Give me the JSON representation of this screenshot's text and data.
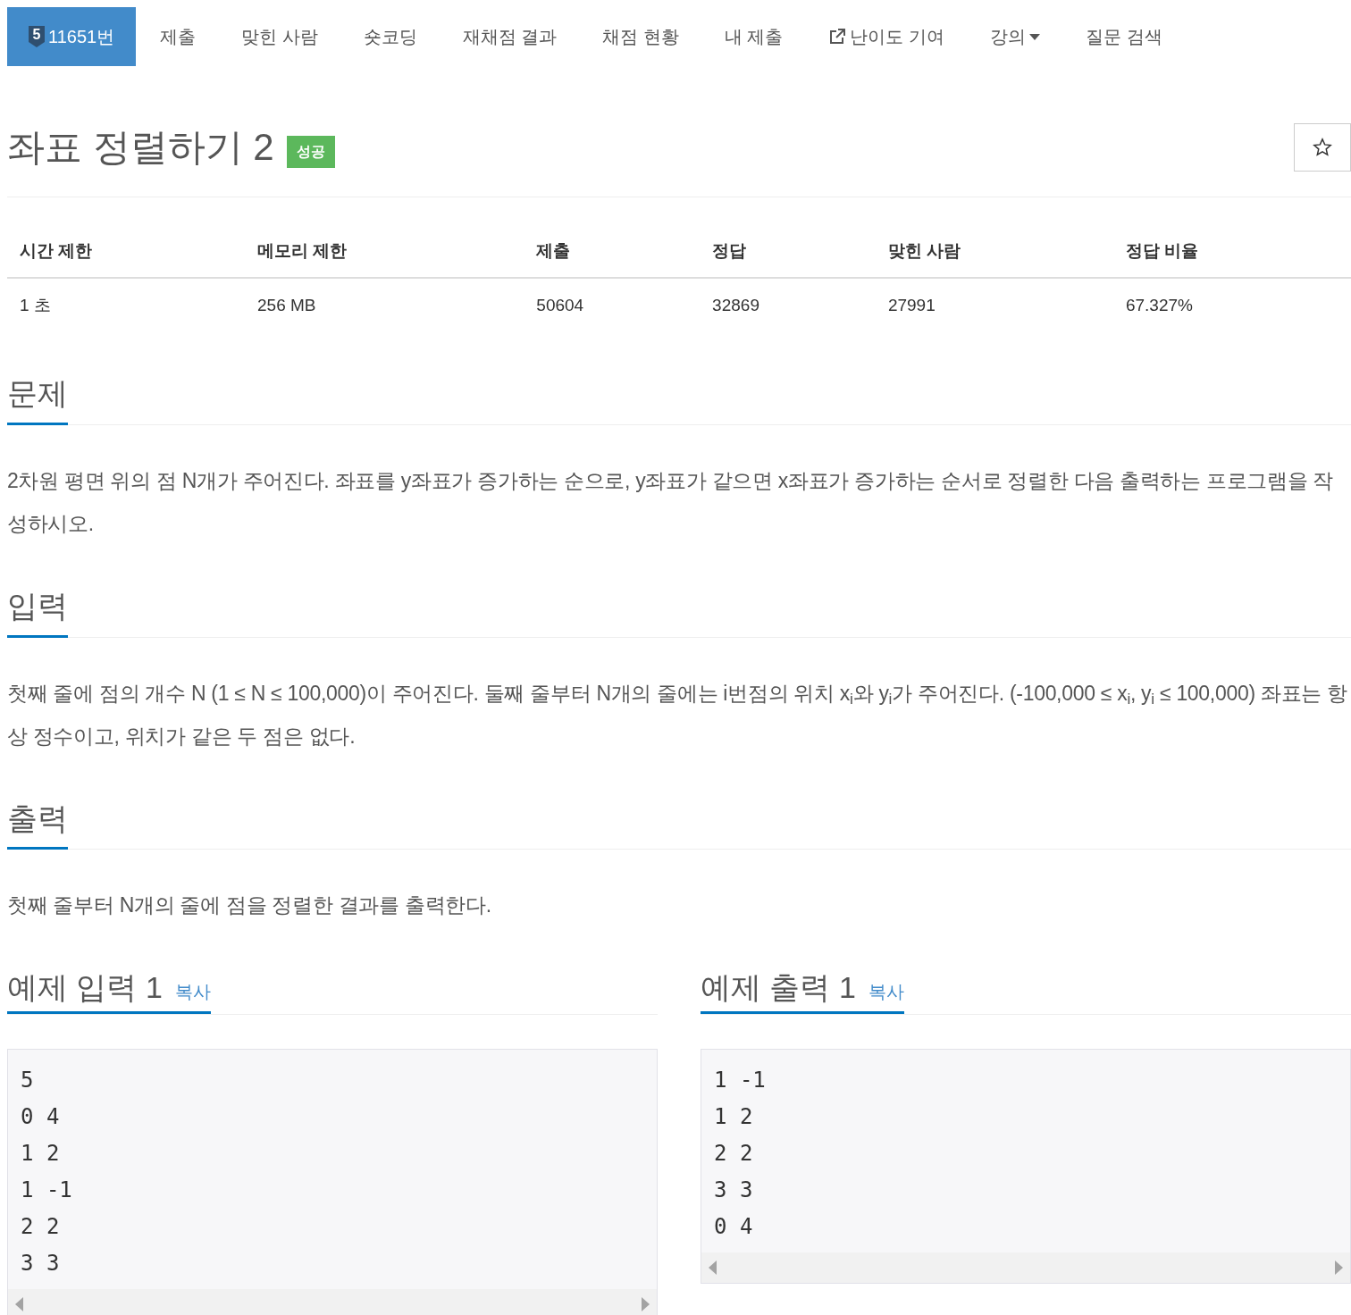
{
  "nav": [
    {
      "label": "11651번",
      "kind": "problem",
      "tier": "5",
      "selected": true
    },
    {
      "label": "제출",
      "kind": "plain",
      "selected": false
    },
    {
      "label": "맞힌 사람",
      "kind": "plain",
      "selected": false
    },
    {
      "label": "숏코딩",
      "kind": "plain",
      "selected": false
    },
    {
      "label": "재채점 결과",
      "kind": "plain",
      "selected": false
    },
    {
      "label": "채점 현황",
      "kind": "plain",
      "selected": false
    },
    {
      "label": "내 제출",
      "kind": "plain",
      "selected": false
    },
    {
      "label": "난이도 기여",
      "kind": "external",
      "selected": false
    },
    {
      "label": "강의",
      "kind": "dropdown",
      "selected": false
    },
    {
      "label": "질문 검색",
      "kind": "plain",
      "selected": false
    }
  ],
  "title": {
    "text": "좌표 정렬하기 2",
    "badge": "성공",
    "starred": false
  },
  "stats": {
    "columns": [
      "시간 제한",
      "메모리 제한",
      "제출",
      "정답",
      "맞힌 사람",
      "정답 비율"
    ],
    "values": [
      "1 초",
      "256 MB",
      "50604",
      "32869",
      "27991",
      "67.327%"
    ]
  },
  "sections": [
    {
      "heading": "문제",
      "text": "2차원 평면 위의 점 N개가 주어진다. 좌표를 y좌표가 증가하는 순으로, y좌표가 같으면 x좌표가 증가하는 순서로 정렬한 다음 출력하는 프로그램을 작성하시오."
    },
    {
      "heading": "입력",
      "text": "첫째 줄에 점의 개수 N (1 ≤ N ≤ 100,000)이 주어진다. 둘째 줄부터 N개의 줄에는 i번점의 위치 x$_{i}$와 y$_{i}$가 주어진다. (-100,000 ≤ x$_{i}$, y$_{i}$ ≤ 100,000) 좌표는 항상 정수이고, 위치가 같은 두 점은 없다."
    },
    {
      "heading": "출력",
      "text": "첫째 줄부터 N개의 줄에 점을 정렬한 결과를 출력한다."
    }
  ],
  "samples": [
    {
      "heading": "예제 입력 1",
      "copy": "복사",
      "lines": [
        "5",
        "0 4",
        "1 2",
        "1 -1",
        "2 2",
        "3 3"
      ]
    },
    {
      "heading": "예제 출력 1",
      "copy": "복사",
      "lines": [
        "1 -1",
        "1 2",
        "2 2",
        "3 3",
        "0 4"
      ]
    }
  ]
}
